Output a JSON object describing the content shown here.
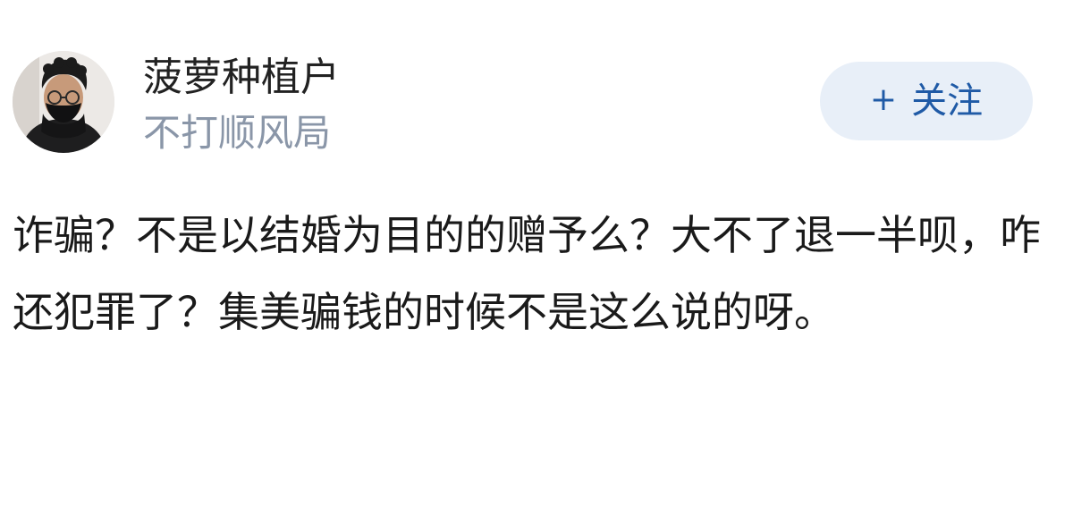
{
  "author": {
    "name": "菠萝种植户",
    "subtitle": "不打顺风局",
    "avatar_icon": "user-avatar-photo"
  },
  "follow_button": {
    "plus": "+",
    "label": "关注",
    "background": "#e8eff8",
    "text_color": "#1f5aa6"
  },
  "post": {
    "text": "诈骗？不是以结婚为目的的赠予么？大不了退一半呗，咋还犯罪了？集美骗钱的时候不是这么说的呀。"
  }
}
